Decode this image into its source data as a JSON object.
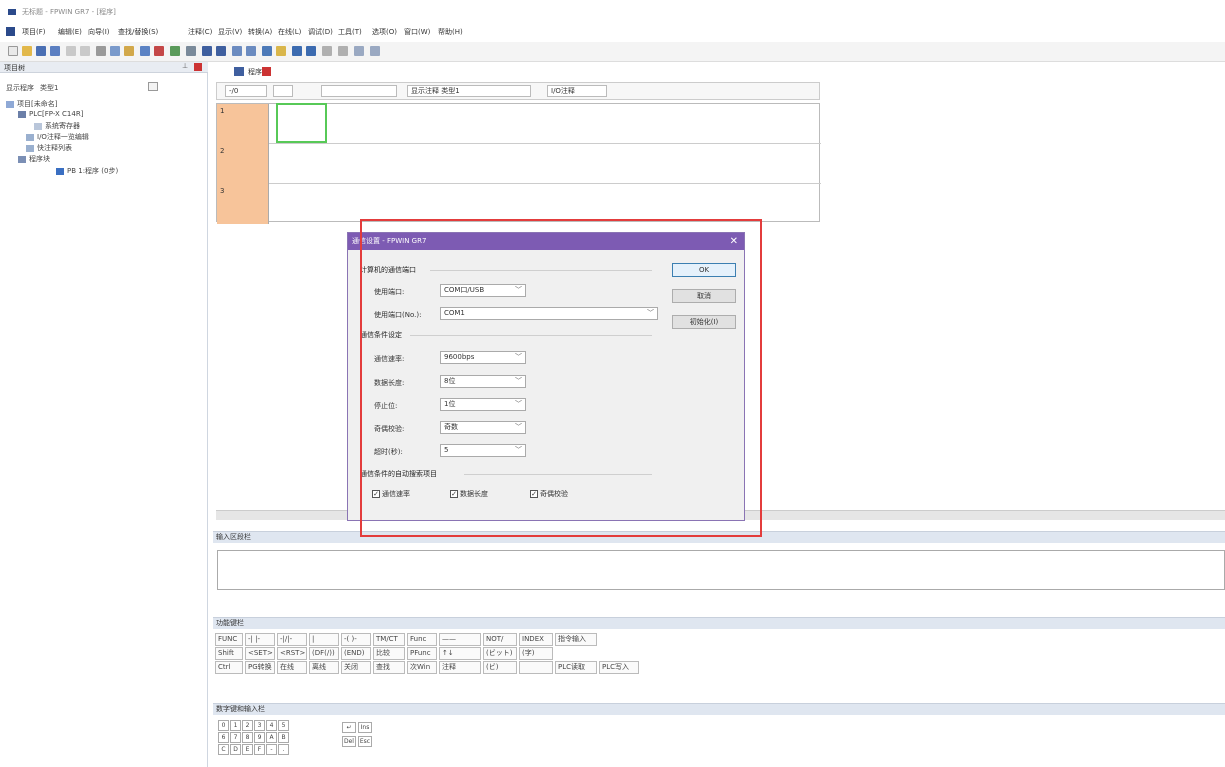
{
  "window": {
    "title": "无标题 - FPWIN GR7 - [程序]"
  },
  "menu": [
    "项目(F)",
    "编辑(E)",
    "向导(I)",
    "查找/替换(S)",
    "注释(C)",
    "显示(V)",
    "转换(A)",
    "在线(L)",
    "调试(D)",
    "工具(T)",
    "选项(O)",
    "窗口(W)",
    "帮助(H)"
  ],
  "project": {
    "header": "项目树",
    "display_label": "显示程序",
    "display_value": "类型1",
    "tree": [
      "项目[未命名]",
      "PLC[FP-X C14R]",
      "系统寄存器",
      "I/O注释一览编辑",
      "快注释列表",
      "程序块",
      "PB 1:程序 (0步)"
    ]
  },
  "program": {
    "tab": "程序",
    "ladder_bar": [
      "-/0",
      "",
      "",
      "显示注释 类型1",
      "I/O注释"
    ],
    "rungs": [
      "1",
      "2",
      "3"
    ]
  },
  "input_panel": {
    "title": "输入区段栏"
  },
  "func_panel": {
    "title": "功能键栏",
    "row1": [
      "FUNC",
      "-| |-",
      "-|/|-",
      "|",
      "-( )-",
      "TM/CT",
      "Func",
      "——",
      "NOT/",
      "INDEX",
      "指令输入"
    ],
    "row2": [
      "Shift",
      "<SET>",
      "<RST>",
      "(DF(/))",
      "(END)",
      "比较",
      "PFunc",
      "↑↓",
      "(ビット)",
      "(字)"
    ],
    "row3": [
      "Ctrl",
      "PG转换",
      "在线",
      "离线",
      "关闭",
      "查找",
      "次Win",
      "注释",
      "(ビ)",
      "",
      "PLC读取",
      "PLC写入"
    ]
  },
  "numpad": {
    "title": "数字键和输入栏",
    "rows": [
      [
        "0",
        "1",
        "2",
        "3",
        "4",
        "5"
      ],
      [
        "6",
        "7",
        "8",
        "9",
        "A",
        "B"
      ],
      [
        "C",
        "D",
        "E",
        "F",
        "-",
        "."
      ]
    ],
    "side": [
      "↵",
      "Ins",
      "Del",
      "Esc"
    ]
  },
  "dialog": {
    "title": "通信设置 - FPWIN GR7",
    "group1": "计算机的通信端口",
    "port_label": "使用端口:",
    "port_value": "COM口/USB",
    "portno_label": "使用端口(No.):",
    "portno_value": "COM1",
    "group2": "通信条件设定",
    "baud_label": "通信速率:",
    "baud_value": "9600bps",
    "len_label": "数据长度:",
    "len_value": "8位",
    "stop_label": "停止位:",
    "stop_value": "1位",
    "parity_label": "奇偶校验:",
    "parity_value": "奇数",
    "timeout_label": "超时(秒):",
    "timeout_value": "5",
    "group3": "通信条件的自动搜索项目",
    "chk1": "通信速率",
    "chk2": "数据长度",
    "chk3": "奇偶校验",
    "ok": "OK",
    "cancel": "取消",
    "init": "初始化(I)"
  },
  "colors": {
    "dialog_title": "#7d5bb3",
    "highlight": "#e33c3c",
    "rung_num": "#f7c49a"
  }
}
